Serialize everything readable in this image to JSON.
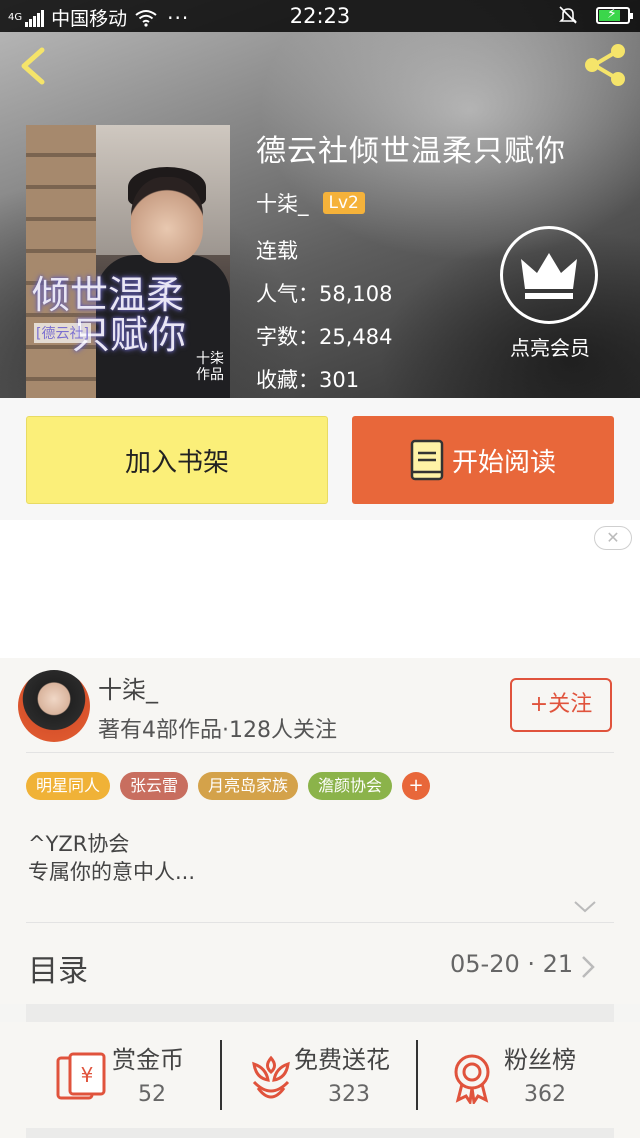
{
  "status_bar": {
    "network": "4G",
    "carrier": "中国移动",
    "time": "22:23"
  },
  "book": {
    "title": "德云社倾世温柔只赋你",
    "author": "十柒_",
    "author_level": "Lv2",
    "status": "连载",
    "popularity": "人气：58,108",
    "word_count": "字数：25,484",
    "favorites": "收藏：301",
    "cover_title_line1": "倾世温柔",
    "cover_title_line2": "只赋你",
    "cover_tag": "[德云社]",
    "cover_signature": "十柒作品"
  },
  "vip": {
    "label": "点亮会员"
  },
  "actions": {
    "add_shelf": "加入书架",
    "start_reading": "开始阅读"
  },
  "ad": {
    "close_label": "✕"
  },
  "author_section": {
    "name": "十柒_",
    "stats": "著有4部作品·128人关注",
    "follow": "+关注",
    "tags": [
      {
        "label": "明星同人",
        "color": "#f0b237"
      },
      {
        "label": "张云雷",
        "color": "#c86e5f"
      },
      {
        "label": "月亮岛家族",
        "color": "#d4a24a"
      },
      {
        "label": "澹颜协会",
        "color": "#8bb34a"
      }
    ],
    "tag_more": "+",
    "description_line1": "^YZR协会",
    "description_line2": "专属你的意中人..."
  },
  "toc": {
    "label": "目录",
    "date": "05-20 · 21"
  },
  "stats": [
    {
      "name": "赏金币",
      "value": "52",
      "icon": "red-envelope-yen-icon"
    },
    {
      "name": "免费送花",
      "value": "323",
      "icon": "flower-icon"
    },
    {
      "name": "粉丝榜",
      "value": "362",
      "icon": "medal-icon"
    }
  ],
  "colors": {
    "accent_orange": "#e8673a",
    "shelf_yellow": "#fbef79",
    "level_badge": "#f5b23a",
    "follow_red": "#e0533c"
  }
}
